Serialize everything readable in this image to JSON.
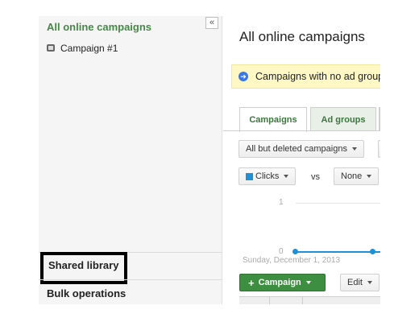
{
  "sidebar": {
    "collapse_glyph": "«",
    "title": "All online campaigns",
    "campaign": "Campaign #1",
    "shared_library": "Shared library",
    "bulk_operations": "Bulk operations"
  },
  "main": {
    "title": "All online campaigns",
    "banner_text": "Campaigns with no ad groups",
    "tabs": [
      "Campaigns",
      "Ad groups"
    ],
    "filter_label": "All but deleted campaigns",
    "metric1": "Clicks",
    "vs": "vs",
    "metric2": "None",
    "chart": {
      "y_ticks": [
        "1",
        "0"
      ],
      "date": "Sunday, December 1, 2013",
      "series_color": "#1f8fd6"
    },
    "add_campaign_label": "Campaign",
    "edit_label": "Edit"
  },
  "colors": {
    "accent_green": "#3e8e41",
    "banner_bg": "#fff8c4",
    "info_blue": "#3b78e7"
  }
}
